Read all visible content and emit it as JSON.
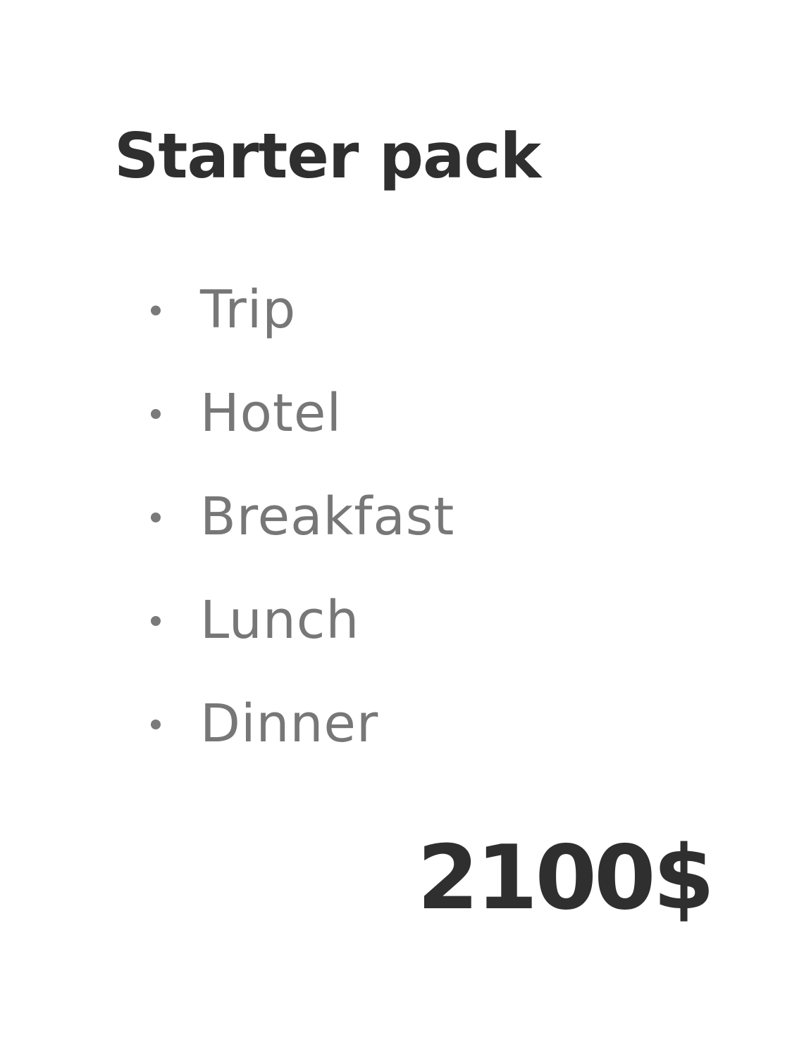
{
  "plan": {
    "title": "Starter pack",
    "features": [
      {
        "label": "Trip"
      },
      {
        "label": "Hotel"
      },
      {
        "label": "Breakfast"
      },
      {
        "label": "Lunch"
      },
      {
        "label": "Dinner"
      }
    ],
    "price": "2100$"
  },
  "colors": {
    "title": "#2f2f2f",
    "feature_text": "#777777",
    "bullet": "#7a7a7a",
    "background": "#ffffff"
  },
  "icons": {
    "bullet": "bullet-dot-icon"
  }
}
